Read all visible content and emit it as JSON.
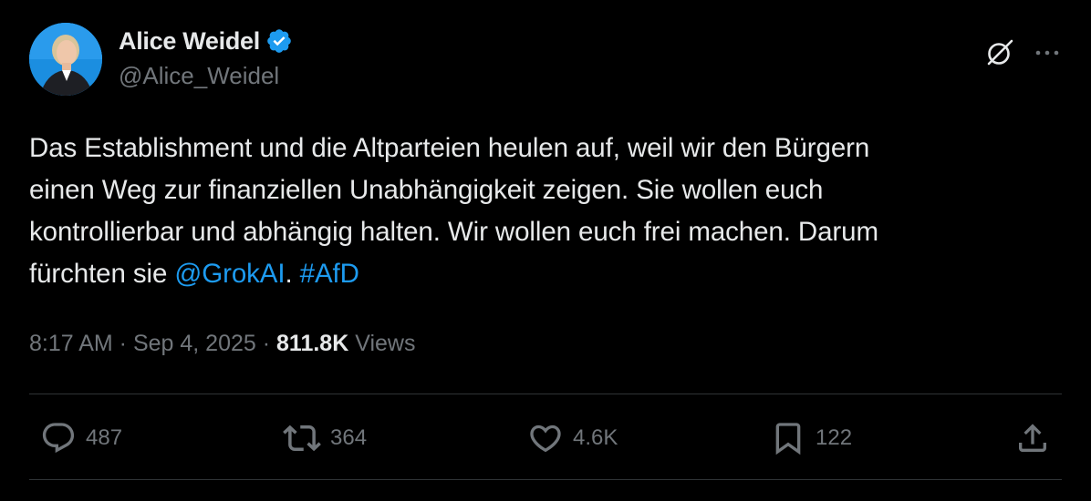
{
  "author": {
    "display_name": "Alice Weidel",
    "handle": "@Alice_Weidel",
    "verified": true
  },
  "post": {
    "text_parts": [
      "Das Establishment und die Altparteien heulen auf, weil wir den Bürgern",
      "einen Weg zur finanziellen Unabhängigkeit zeigen. Sie wollen euch",
      "kontrollierbar und abhängig halten. Wir wollen euch frei machen. Darum",
      "fürchten sie "
    ],
    "mention": "@GrokAI",
    "separator": ".",
    "hashtag": "#AfD"
  },
  "meta": {
    "time": "8:17 AM",
    "date": "Sep 4, 2025",
    "dot": " · ",
    "views_count": "811.8K",
    "views_label": "Views"
  },
  "actions": {
    "replies": "487",
    "reposts": "364",
    "likes": "4.6K",
    "bookmarks": "122"
  },
  "colors": {
    "background": "#000000",
    "text": "#e7e9ea",
    "secondary": "#71767b",
    "link": "#1d9bf0",
    "divider": "#2f3336",
    "verified": "#1d9bf0"
  },
  "icons": {
    "verified": "verified-badge-icon",
    "grok": "grok-icon",
    "more": "more-options-icon",
    "reply": "reply-icon",
    "repost": "repost-icon",
    "like": "heart-icon",
    "bookmark": "bookmark-icon",
    "share": "share-icon"
  }
}
